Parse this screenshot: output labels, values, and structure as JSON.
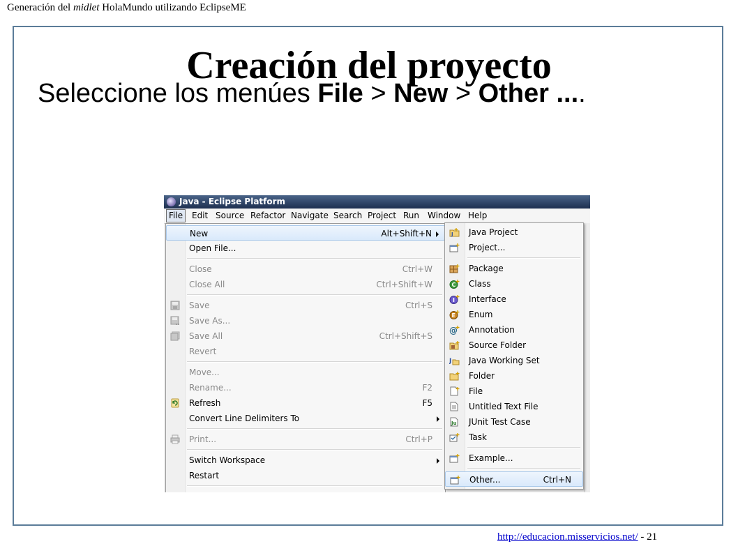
{
  "header": {
    "prefix": "Generación del ",
    "italic": "midlet",
    "suffix": " HolaMundo utilizando EclipseME"
  },
  "slide": {
    "title": "Creación del proyecto",
    "instruction": {
      "t1": "Seleccione los menúes ",
      "b1": "File",
      "t2": " > ",
      "b2": "New",
      "t3": " > ",
      "b3": "Other ...",
      "t4": "."
    }
  },
  "footer": {
    "url": "http://educacion.misservicios.net/",
    "page": " - 21"
  },
  "eclipse": {
    "window_title": "Java - Eclipse Platform",
    "menubar": [
      "File",
      "Edit",
      "Source",
      "Refactor",
      "Navigate",
      "Search",
      "Project",
      "Run",
      "Window",
      "Help"
    ],
    "file_menu": [
      {
        "label": "New",
        "shortcut": "Alt+Shift+N",
        "submenu": true,
        "highlighted": true
      },
      {
        "label": "Open File..."
      },
      {
        "label": "Close",
        "shortcut": "Ctrl+W",
        "disabled": true
      },
      {
        "label": "Close All",
        "shortcut": "Ctrl+Shift+W",
        "disabled": true
      },
      {
        "label": "Save",
        "shortcut": "Ctrl+S",
        "disabled": true,
        "icon": "save-icon"
      },
      {
        "label": "Save As...",
        "disabled": true,
        "icon": "save-as-icon"
      },
      {
        "label": "Save All",
        "shortcut": "Ctrl+Shift+S",
        "disabled": true,
        "icon": "save-all-icon"
      },
      {
        "label": "Revert",
        "disabled": true
      },
      {
        "label": "Move...",
        "disabled": true
      },
      {
        "label": "Rename...",
        "shortcut": "F2",
        "disabled": true
      },
      {
        "label": "Refresh",
        "shortcut": "F5",
        "icon": "refresh-icon"
      },
      {
        "label": "Convert Line Delimiters To",
        "submenu": true
      },
      {
        "label": "Print...",
        "shortcut": "Ctrl+P",
        "disabled": true,
        "icon": "print-icon"
      },
      {
        "label": "Switch Workspace",
        "submenu": true
      },
      {
        "label": "Restart"
      }
    ],
    "new_submenu": [
      {
        "label": "Java Project",
        "icon": "java-project-icon"
      },
      {
        "label": "Project...",
        "icon": "project-icon"
      },
      {
        "label": "Package",
        "icon": "package-icon"
      },
      {
        "label": "Class",
        "icon": "class-icon"
      },
      {
        "label": "Interface",
        "icon": "interface-icon"
      },
      {
        "label": "Enum",
        "icon": "enum-icon"
      },
      {
        "label": "Annotation",
        "icon": "annotation-icon"
      },
      {
        "label": "Source Folder",
        "icon": "source-folder-icon"
      },
      {
        "label": "Java Working Set",
        "icon": "java-working-set-icon"
      },
      {
        "label": "Folder",
        "icon": "folder-icon"
      },
      {
        "label": "File",
        "icon": "file-icon"
      },
      {
        "label": "Untitled Text File",
        "icon": "text-file-icon"
      },
      {
        "label": "JUnit Test Case",
        "icon": "junit-icon"
      },
      {
        "label": "Task",
        "icon": "task-icon"
      },
      {
        "label": "Example...",
        "icon": "example-icon"
      },
      {
        "label": "Other...",
        "shortcut": "Ctrl+N",
        "highlighted": true,
        "icon": "other-wizard-icon"
      }
    ]
  }
}
